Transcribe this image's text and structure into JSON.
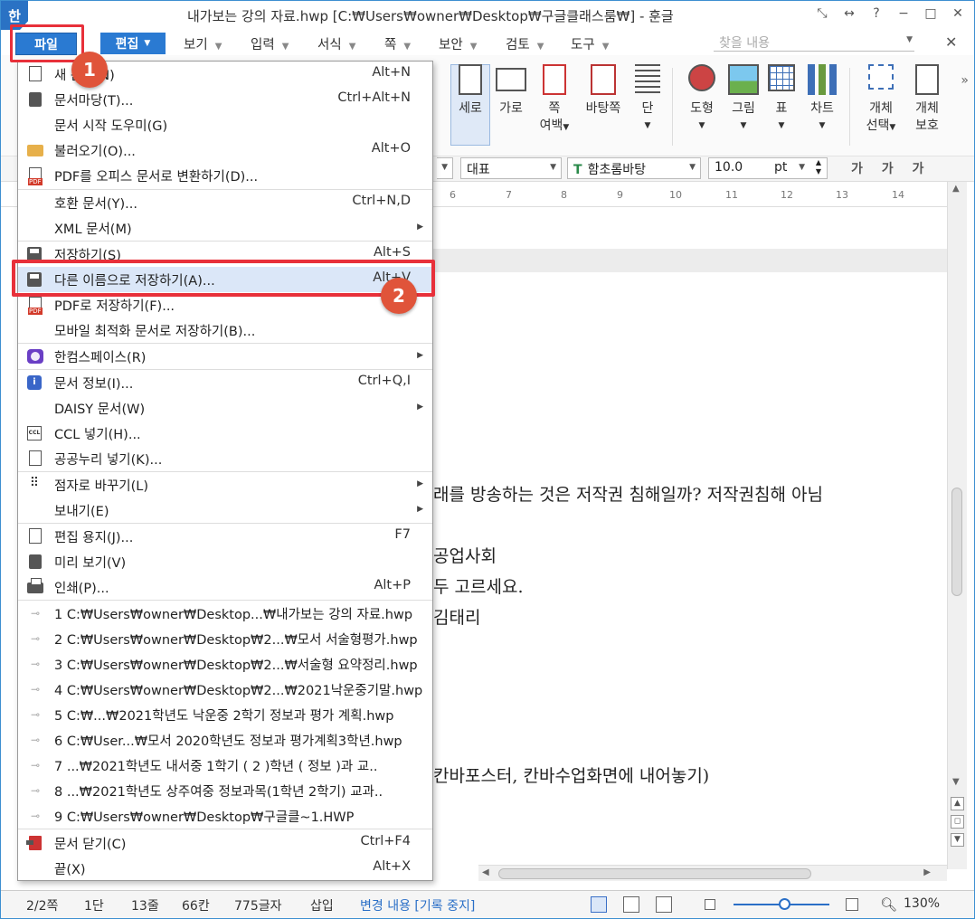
{
  "titlebar": {
    "logo": "한",
    "title": "내가보는 강의 자료.hwp [C:₩Users₩owner₩Desktop₩구글클래스룸₩] - 훈글",
    "buttons": [
      "⤡",
      "↔",
      "?",
      "−",
      "□",
      "✕"
    ]
  },
  "menubar": {
    "file": "파일",
    "edit": "편집",
    "items": [
      "보기",
      "입력",
      "서식",
      "쪽",
      "보안",
      "검토",
      "도구"
    ],
    "search_placeholder": "찾을 내용",
    "close": "✕"
  },
  "annotations": {
    "badge1": "1",
    "badge2": "2"
  },
  "toolbar": {
    "buttons": [
      {
        "label": "세로",
        "sub": ""
      },
      {
        "label": "가로",
        "sub": ""
      },
      {
        "label": "쪽",
        "sub": "여백"
      },
      {
        "label": "바탕쪽",
        "sub": ""
      },
      {
        "label": "단",
        "sub": ""
      },
      {
        "label": "도형",
        "sub": ""
      },
      {
        "label": "그림",
        "sub": ""
      },
      {
        "label": "표",
        "sub": ""
      },
      {
        "label": "차트",
        "sub": ""
      },
      {
        "label": "개체",
        "sub": "선택"
      },
      {
        "label": "개체",
        "sub": "보호"
      }
    ]
  },
  "formatbar": {
    "style": "대표",
    "font": "함초롬바탕",
    "font_icon": "T",
    "size": "10.0",
    "unit": "pt",
    "styles": "가 가 가"
  },
  "ruler": {
    "numbers": [
      "6",
      "7",
      "8",
      "9",
      "10",
      "11",
      "12",
      "13",
      "14"
    ]
  },
  "document": {
    "lines": [
      "래를 방송하는 것은 저작권 침해일까?  저작권침해 아님",
      "공업사회",
      "두 고르세요.",
      "김태리",
      "칸바포스터, 칸바수업화면에 내어놓기)"
    ]
  },
  "file_menu": {
    "items": [
      {
        "label": "새 문서(N)",
        "shortcut": "Alt+N",
        "icon": "new-doc"
      },
      {
        "label": "문서마당(T)...",
        "shortcut": "Ctrl+Alt+N",
        "icon": "template"
      },
      {
        "label": "문서 시작 도우미(G)",
        "shortcut": "",
        "icon": ""
      },
      {
        "label": "불러오기(O)...",
        "shortcut": "Alt+O",
        "icon": "folder"
      },
      {
        "label": "PDF를 오피스 문서로 변환하기(D)...",
        "shortcut": "",
        "icon": "pdf"
      },
      {
        "label": "호환 문서(Y)...",
        "shortcut": "Ctrl+N,D",
        "icon": ""
      },
      {
        "label": "XML 문서(M)",
        "shortcut": "",
        "icon": "",
        "submenu": true
      },
      {
        "label": "저장하기(S)",
        "shortcut": "Alt+S",
        "icon": "save"
      },
      {
        "label": "다른 이름으로 저장하기(A)...",
        "shortcut": "Alt+V",
        "icon": "save-as"
      },
      {
        "label": "PDF로 저장하기(F)...",
        "shortcut": "",
        "icon": "pdf"
      },
      {
        "label": "모바일 최적화 문서로 저장하기(B)...",
        "shortcut": "",
        "icon": ""
      },
      {
        "label": "한컴스페이스(R)",
        "shortcut": "",
        "icon": "hancom-space",
        "submenu": true
      },
      {
        "label": "문서 정보(I)...",
        "shortcut": "Ctrl+Q,I",
        "icon": "info"
      },
      {
        "label": "DAISY 문서(W)",
        "shortcut": "",
        "icon": "",
        "submenu": true
      },
      {
        "label": "CCL 넣기(H)...",
        "shortcut": "",
        "icon": "ccl"
      },
      {
        "label": "공공누리 넣기(K)...",
        "shortcut": "",
        "icon": "kogl"
      },
      {
        "label": "점자로 바꾸기(L)",
        "shortcut": "",
        "icon": "braille",
        "submenu": true
      },
      {
        "label": "보내기(E)",
        "shortcut": "",
        "icon": "",
        "submenu": true
      },
      {
        "label": "편집 용지(J)...",
        "shortcut": "F7",
        "icon": "page-setup"
      },
      {
        "label": "미리 보기(V)",
        "shortcut": "",
        "icon": "preview"
      },
      {
        "label": "인쇄(P)...",
        "shortcut": "Alt+P",
        "icon": "print"
      },
      {
        "label": "1 C:₩Users₩owner₩Desktop...₩내가보는 강의 자료.hwp",
        "shortcut": "",
        "icon": "recent"
      },
      {
        "label": "2 C:₩Users₩owner₩Desktop₩2...₩모서 서술형평가.hwp",
        "shortcut": "",
        "icon": "recent"
      },
      {
        "label": "3 C:₩Users₩owner₩Desktop₩2...₩서술형 요약정리.hwp",
        "shortcut": "",
        "icon": "recent"
      },
      {
        "label": "4 C:₩Users₩owner₩Desktop₩2...₩2021낙운중기말.hwp",
        "shortcut": "",
        "icon": "recent"
      },
      {
        "label": "5 C:₩...₩2021학년도 낙운중 2학기 정보과 평가 계획.hwp",
        "shortcut": "",
        "icon": "recent"
      },
      {
        "label": "6 C:₩User...₩모서 2020학년도 정보과 평가계획3학년.hwp",
        "shortcut": "",
        "icon": "recent"
      },
      {
        "label": "7 ...₩2021학년도 내서중 1학기 ( 2 )학년 (  정보  )과 교..",
        "shortcut": "",
        "icon": "recent"
      },
      {
        "label": "8 ...₩2021학년도 상주여중 정보과목(1학년 2학기) 교과..",
        "shortcut": "",
        "icon": "recent"
      },
      {
        "label": "9 C:₩Users₩owner₩Desktop₩구글클~1.HWP",
        "shortcut": "",
        "icon": "recent"
      },
      {
        "label": "문서 닫기(C)",
        "shortcut": "Ctrl+F4",
        "icon": "close-doc"
      },
      {
        "label": "끝(X)",
        "shortcut": "Alt+X",
        "icon": ""
      }
    ]
  },
  "statusbar": {
    "page": "2/2쪽",
    "column": "1단",
    "line": "13줄",
    "col": "66칸",
    "chars": "775글자",
    "mode": "삽입",
    "change": "변경 내용 [기록 중지]",
    "zoom": "130%",
    "zoom_level": 0.5
  }
}
